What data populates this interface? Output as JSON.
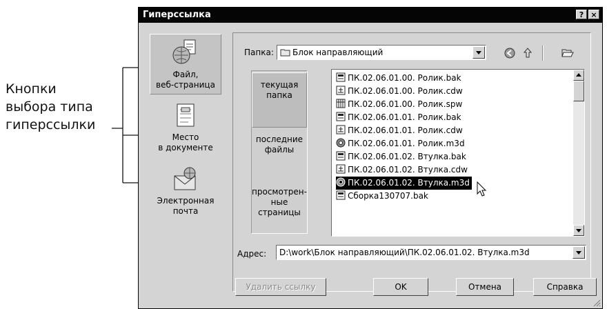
{
  "annotation": {
    "lines": [
      "Кнопки",
      "выбора типа",
      "гиперссылки"
    ]
  },
  "dialog": {
    "title": "Гиперссылка",
    "help_label": "?",
    "close_label": "×"
  },
  "link_types": [
    {
      "label": "Файл,\nвеб-страница",
      "icon": "file-web-icon",
      "active": true
    },
    {
      "label": "Место\nв документе",
      "icon": "document-place-icon",
      "active": false
    },
    {
      "label": "Электронная\nпочта",
      "icon": "email-icon",
      "active": false
    }
  ],
  "folder": {
    "label": "Папка:",
    "value": "Блок направляющий"
  },
  "places": [
    {
      "label": "текущая\nпапка",
      "selected": true
    },
    {
      "label": "последние\nфайлы",
      "selected": false
    },
    {
      "label": "просмотрен-\nные\nстраницы",
      "selected": false
    }
  ],
  "files": [
    {
      "name": "ПК.02.06.01.00. Ролик.bak",
      "icon": "bak-file-icon",
      "selected": false
    },
    {
      "name": "ПК.02.06.01.00. Ролик.cdw",
      "icon": "cdw-file-icon",
      "selected": false
    },
    {
      "name": "ПК.02.06.01.00. Ролик.spw",
      "icon": "spw-file-icon",
      "selected": false
    },
    {
      "name": "ПК.02.06.01.01. Ролик.bak",
      "icon": "bak-file-icon",
      "selected": false
    },
    {
      "name": "ПК.02.06.01.01. Ролик.cdw",
      "icon": "cdw-file-icon",
      "selected": false
    },
    {
      "name": "ПК.02.06.01.01. Ролик.m3d",
      "icon": "m3d-file-icon",
      "selected": false
    },
    {
      "name": "ПК.02.06.01.02. Втулка.bak",
      "icon": "bak-file-icon",
      "selected": false
    },
    {
      "name": "ПК.02.06.01.02. Втулка.cdw",
      "icon": "cdw-file-icon",
      "selected": false
    },
    {
      "name": "ПК.02.06.01.02. Втулка.m3d",
      "icon": "m3d-file-icon",
      "selected": true
    },
    {
      "name": "Сборка130707.bak",
      "icon": "bak-file-icon",
      "selected": false
    }
  ],
  "address": {
    "label": "Адрес:",
    "value": "D:\\work\\Блок направляющий\\ПК.02.06.01.02. Втулка.m3d"
  },
  "buttons": {
    "remove_link": "Удалить ссылку",
    "ok": "OK",
    "cancel": "Отмена",
    "help": "Справка"
  }
}
